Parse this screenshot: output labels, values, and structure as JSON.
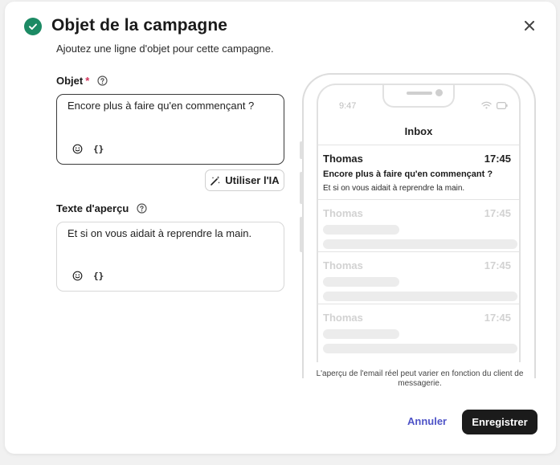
{
  "dialog": {
    "title": "Objet de la campagne",
    "subtitle": "Ajoutez une ligne d'objet pour cette campagne.",
    "colors": {
      "success": "#1c8a64",
      "accent": "#4e53c7",
      "required": "#d1335b",
      "primary_button": "#1b1b1b"
    }
  },
  "subject": {
    "label": "Objet",
    "required_marker": "*",
    "value": "Encore plus à faire qu'en commençant ?",
    "variables_label": "{}",
    "ai_button_label": "Utiliser l'IA"
  },
  "preview_text": {
    "label": "Texte d'aperçu",
    "value": "Et si on vous aidait à reprendre la main.",
    "variables_label": "{}"
  },
  "phone_preview": {
    "status_time": "9:47",
    "title": "Inbox",
    "messages": [
      {
        "from": "Thomas",
        "time": "17:45",
        "subject": "Encore plus à faire qu'en commençant ?",
        "preview": "Et si on vous aidait à reprendre la main."
      },
      {
        "from": "Thomas",
        "time": "17:45"
      },
      {
        "from": "Thomas",
        "time": "17:45"
      },
      {
        "from": "Thomas",
        "time": "17:45"
      }
    ],
    "disclaimer": "L'aperçu de l'email réel peut varier en fonction du client de messagerie."
  },
  "footer": {
    "cancel_label": "Annuler",
    "save_label": "Enregistrer"
  }
}
